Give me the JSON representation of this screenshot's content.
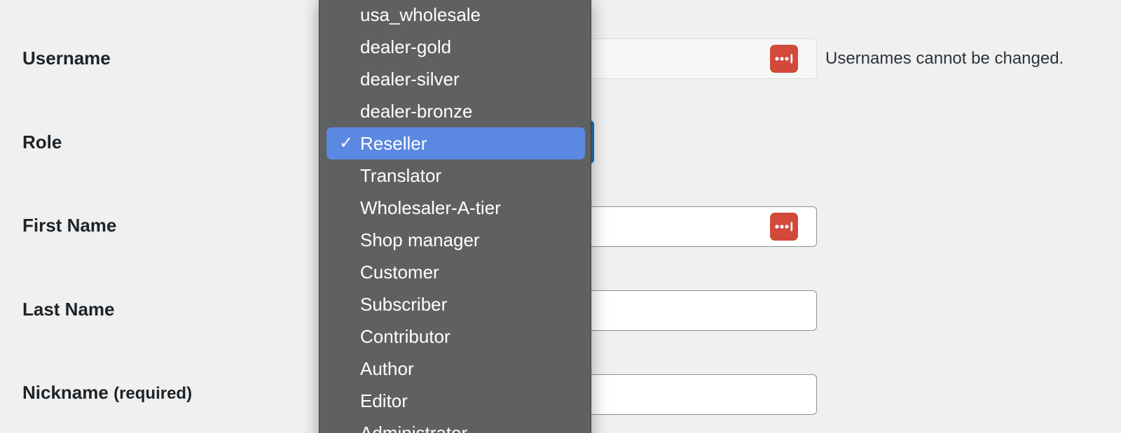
{
  "form": {
    "username": {
      "label": "Username",
      "hint": "Usernames cannot be changed."
    },
    "role": {
      "label": "Role",
      "selected": "Reseller"
    },
    "first_name": {
      "label": "First Name"
    },
    "last_name": {
      "label": "Last Name"
    },
    "nickname": {
      "label": "Nickname",
      "required": "(required)"
    }
  },
  "role_dropdown": {
    "options": [
      "usa_wholesale",
      "dealer-gold",
      "dealer-silver",
      "dealer-bronze",
      "Reseller",
      "Translator",
      "Wholesaler-A-tier",
      "Shop manager",
      "Customer",
      "Subscriber",
      "Contributor",
      "Author",
      "Editor",
      "Administrator"
    ],
    "check_mark": "✓"
  },
  "icons": {
    "password_manager": "password-manager-icon"
  },
  "colors": {
    "background": "#f0f0f1",
    "dropdown": "#5f6060",
    "selected_option": "#5b88e0",
    "password_icon": "#d24a3c",
    "select_accent": "#2271b1"
  }
}
